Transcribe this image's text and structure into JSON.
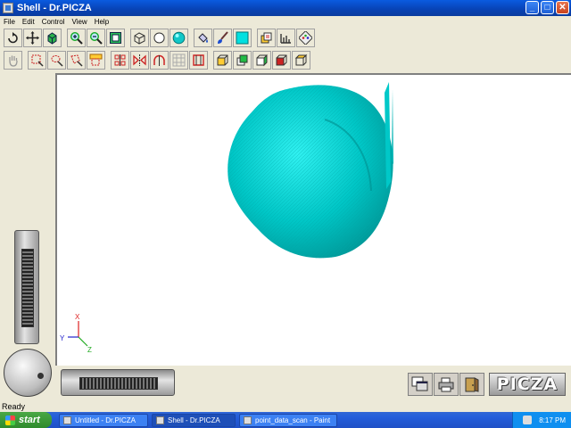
{
  "window": {
    "title": "Shell - Dr.PICZA"
  },
  "menu": {
    "items": [
      "File",
      "Edit",
      "Control",
      "View",
      "Help"
    ]
  },
  "toolbar1": [
    "rotate",
    "move",
    "cube-color",
    "zoom-in",
    "zoom-out",
    "zoom-fit",
    "wireframe",
    "surface",
    "sphere",
    "paint-bucket",
    "brush",
    "color-swatch",
    "layers",
    "measure",
    "palette"
  ],
  "toolbar2": [
    "hand",
    "select-rect",
    "select-lasso",
    "select-poly",
    "select-auto",
    "cut",
    "mirror",
    "arch",
    "grid",
    "frame",
    "view-front",
    "view-back",
    "view-left",
    "view-right",
    "view-top"
  ],
  "axes": {
    "x": "X",
    "y": "Y",
    "z": "Z"
  },
  "brand": {
    "logo": "PICZA",
    "model_color": "#00c8c8"
  },
  "status": {
    "text": "Ready"
  },
  "taskbar": {
    "start": "start",
    "tasks": [
      "Untitled - Dr.PICZA",
      "Shell - Dr.PICZA",
      "point_data_scan - Paint"
    ],
    "clock": "8:17 PM"
  }
}
